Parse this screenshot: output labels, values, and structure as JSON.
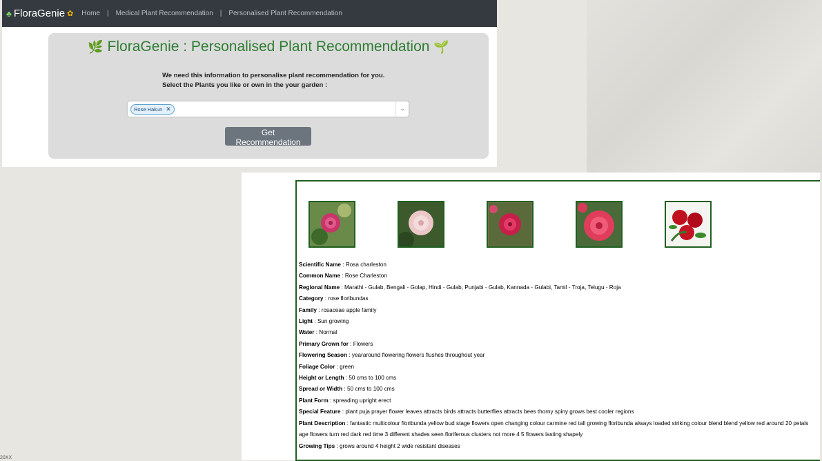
{
  "navbar": {
    "brand": "FloraGenie",
    "brand_icon_left": "clover-icon",
    "brand_icon_right": "sun-icon",
    "links": [
      "Home",
      "Medical Plant Recommendation",
      "Personalised Plant Recommendation"
    ],
    "separator": "|"
  },
  "form": {
    "title": "FloraGenie : Personalised Plant Recommendation",
    "info_line1": "We need this information to personalise plant recommendation for you.",
    "info_line2": "Select the Plants you like or own in the your garden :",
    "selected_chip": "Rose Hakun",
    "button": "Get Recommendation"
  },
  "results": {
    "images": [
      "rose-image-1",
      "rose-image-2",
      "rose-image-3",
      "rose-image-4",
      "rose-image-5"
    ],
    "fields": [
      {
        "label": "Scientific Name",
        "sep": " : ",
        "value": "Rosa charleston"
      },
      {
        "label": "Common Name",
        "sep": " : ",
        "value": "Rose Charleston"
      },
      {
        "label": "Regional Name",
        "sep": " : ",
        "value": "Marathi - Gulab, Bengali - Golap, Hindi - Gulab, Punjabi - Gulab, Kannada - Gulabi, Tamil - Troja, Telugu - Roja"
      },
      {
        "label": "Category",
        "sep": " : ",
        "value": "rose floribundas"
      },
      {
        "label": "Family",
        "sep": " : ",
        "value": "rosaceae apple family"
      },
      {
        "label": "Light",
        "sep": " : ",
        "value": "Sun growing"
      },
      {
        "label": "Water",
        "sep": " : ",
        "value": "Normal"
      },
      {
        "label": "Primary Grown for",
        "sep": " : ",
        "value": "Flowers"
      },
      {
        "label": "Flowering Season",
        "sep": " : ",
        "value": "yeararound flowering flowers flushes throughout year"
      },
      {
        "label": "Foliage Color",
        "sep": " : ",
        "value": "green"
      },
      {
        "label": "Height or Length",
        "sep": " : ",
        "value": "50 cms to 100 cms"
      },
      {
        "label": "Spread or Width",
        "sep": " : ",
        "value": "50 cms to 100 cms"
      },
      {
        "label": "Plant Form",
        "sep": " : ",
        "value": "spreading upright erect"
      },
      {
        "label": "Special Feature",
        "sep": " : ",
        "value": "plant puja prayer flower leaves attracts birds attracts butterflies attracts bees thorny spiny grows best cooler regions"
      },
      {
        "label": "Plant Description",
        "sep": " : ",
        "value": "fantastic multicolour floribunda yellow bud stage flowers open changing colour carmine red tall growing floribunda always loaded striking colour blend blend yellow red around 20 petals age flowers turn red dark red time 3 different shades seen floriferous clusters not more 4 5 flowers lasting shapely"
      },
      {
        "label": "Growing Tips",
        "sep": " : ",
        "value": "grows around 4 height 2 wide resistant diseases"
      }
    ]
  },
  "corner_text": "20XX"
}
